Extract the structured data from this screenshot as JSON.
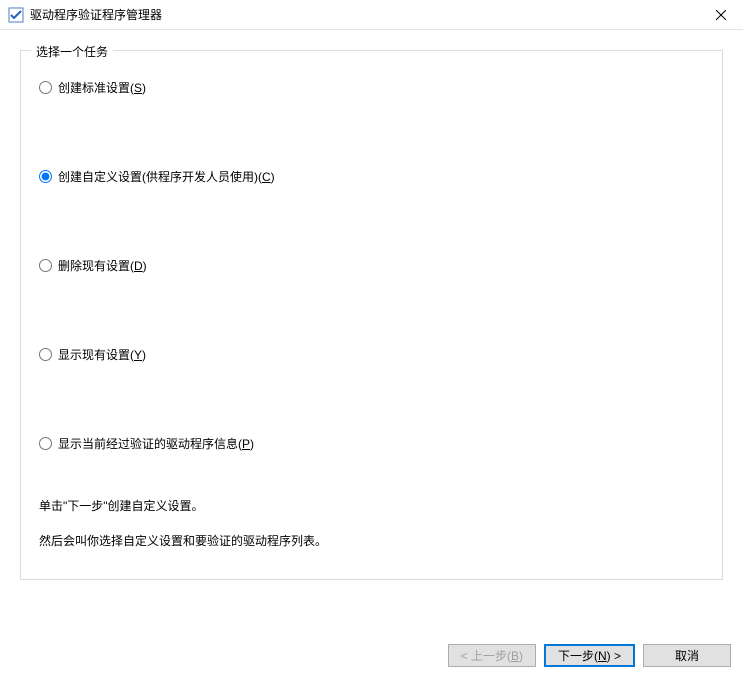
{
  "window": {
    "title": "驱动程序验证程序管理器"
  },
  "groupbox": {
    "legend": "选择一个任务"
  },
  "radios": {
    "r0": {
      "label": "创建标准设置(",
      "hotkey": "S",
      "suffix": ")"
    },
    "r1": {
      "label": "创建自定义设置(供程序开发人员使用)(",
      "hotkey": "C",
      "suffix": ")"
    },
    "r2": {
      "label": "删除现有设置(",
      "hotkey": "D",
      "suffix": ")"
    },
    "r3": {
      "label": "显示现有设置(",
      "hotkey": "Y",
      "suffix": ")"
    },
    "r4": {
      "label": "显示当前经过验证的驱动程序信息(",
      "hotkey": "P",
      "suffix": ")"
    }
  },
  "description": {
    "line1": "单击\"下一步\"创建自定义设置。",
    "line2": "然后会叫你选择自定义设置和要验证的驱动程序列表。"
  },
  "buttons": {
    "back": {
      "prefix": "< 上一步(",
      "hotkey": "B",
      "suffix": ")"
    },
    "next": {
      "prefix": "下一步(",
      "hotkey": "N",
      "suffix": ") >"
    },
    "cancel": {
      "label": "取消"
    }
  }
}
